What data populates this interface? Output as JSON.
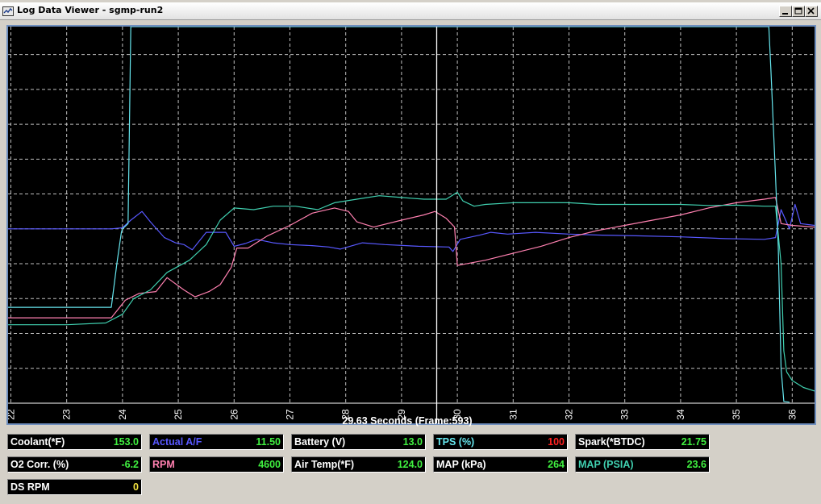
{
  "window": {
    "title": "Log Data Viewer - sgmp-run2",
    "icon": "log-viewer-icon",
    "controls": [
      "minimize-icon",
      "maximize-icon",
      "close-icon"
    ]
  },
  "colors": {
    "plot_background": "#000000",
    "grid": "#bfbfbf",
    "cursor_line": "#ffffff",
    "series_af": "#5858ff",
    "series_rpm": "#ff80b0",
    "series_map_kpa": "#40d0b0",
    "series_map_psia": "#66e6ee"
  },
  "chart_data": {
    "type": "line",
    "xlabel": "",
    "ylabel": "",
    "xlim": [
      21.95,
      36.4
    ],
    "ylim": [
      0,
      10.8
    ],
    "grid": true,
    "x_ticks": [
      "22",
      "23",
      "24",
      "25",
      "26",
      "27",
      "28",
      "29",
      "30",
      "31",
      "32",
      "33",
      "34",
      "35",
      "36"
    ],
    "cursor_x": 29.63,
    "series": [
      {
        "color": "#5858ff",
        "points": [
          [
            21.95,
            5.0
          ],
          [
            23.8,
            5.0
          ],
          [
            24.0,
            5.03
          ],
          [
            24.15,
            5.25
          ],
          [
            24.35,
            5.5
          ],
          [
            24.5,
            5.2
          ],
          [
            24.75,
            4.75
          ],
          [
            24.95,
            4.6
          ],
          [
            25.1,
            4.55
          ],
          [
            25.25,
            4.4
          ],
          [
            25.5,
            4.9
          ],
          [
            25.85,
            4.9
          ],
          [
            26.0,
            4.5
          ],
          [
            26.2,
            4.58
          ],
          [
            26.4,
            4.7
          ],
          [
            26.7,
            4.6
          ],
          [
            27.0,
            4.55
          ],
          [
            27.4,
            4.52
          ],
          [
            27.7,
            4.48
          ],
          [
            27.9,
            4.42
          ],
          [
            28.3,
            4.6
          ],
          [
            28.7,
            4.55
          ],
          [
            29.3,
            4.5
          ],
          [
            29.85,
            4.48
          ],
          [
            29.92,
            4.35
          ],
          [
            30.05,
            4.7
          ],
          [
            30.4,
            4.82
          ],
          [
            30.6,
            4.9
          ],
          [
            30.9,
            4.85
          ],
          [
            31.4,
            4.9
          ],
          [
            32.0,
            4.85
          ],
          [
            32.6,
            4.82
          ],
          [
            33.2,
            4.8
          ],
          [
            34.0,
            4.77
          ],
          [
            34.8,
            4.72
          ],
          [
            35.5,
            4.7
          ],
          [
            35.7,
            4.75
          ],
          [
            35.8,
            5.55
          ],
          [
            35.95,
            5.0
          ],
          [
            36.05,
            5.7
          ],
          [
            36.15,
            5.15
          ],
          [
            36.4,
            5.1
          ]
        ]
      },
      {
        "color": "#ff80b0",
        "points": [
          [
            21.95,
            2.45
          ],
          [
            23.8,
            2.45
          ],
          [
            24.05,
            2.95
          ],
          [
            24.3,
            3.15
          ],
          [
            24.6,
            3.2
          ],
          [
            24.8,
            3.6
          ],
          [
            25.1,
            3.25
          ],
          [
            25.3,
            3.05
          ],
          [
            25.55,
            3.2
          ],
          [
            25.75,
            3.4
          ],
          [
            25.95,
            3.9
          ],
          [
            26.05,
            4.45
          ],
          [
            26.25,
            4.45
          ],
          [
            26.6,
            4.8
          ],
          [
            27.0,
            5.1
          ],
          [
            27.4,
            5.45
          ],
          [
            27.8,
            5.6
          ],
          [
            28.05,
            5.5
          ],
          [
            28.2,
            5.2
          ],
          [
            28.5,
            5.05
          ],
          [
            29.0,
            5.25
          ],
          [
            29.4,
            5.4
          ],
          [
            29.6,
            5.5
          ],
          [
            29.8,
            5.3
          ],
          [
            29.95,
            5.05
          ],
          [
            30.0,
            3.95
          ],
          [
            30.5,
            4.1
          ],
          [
            31.0,
            4.3
          ],
          [
            31.5,
            4.5
          ],
          [
            32.0,
            4.75
          ],
          [
            32.5,
            4.95
          ],
          [
            33.0,
            5.1
          ],
          [
            33.5,
            5.25
          ],
          [
            34.0,
            5.4
          ],
          [
            34.5,
            5.6
          ],
          [
            35.0,
            5.75
          ],
          [
            35.5,
            5.85
          ],
          [
            35.7,
            5.9
          ],
          [
            35.8,
            5.15
          ],
          [
            36.0,
            5.1
          ],
          [
            36.4,
            5.05
          ]
        ]
      },
      {
        "color": "#40d0b0",
        "points": [
          [
            21.95,
            2.25
          ],
          [
            23.0,
            2.25
          ],
          [
            23.7,
            2.3
          ],
          [
            24.0,
            2.55
          ],
          [
            24.2,
            3.0
          ],
          [
            24.5,
            3.25
          ],
          [
            24.8,
            3.75
          ],
          [
            25.2,
            4.1
          ],
          [
            25.5,
            4.55
          ],
          [
            25.75,
            5.25
          ],
          [
            26.0,
            5.6
          ],
          [
            26.35,
            5.55
          ],
          [
            26.7,
            5.65
          ],
          [
            27.1,
            5.65
          ],
          [
            27.5,
            5.55
          ],
          [
            27.8,
            5.75
          ],
          [
            28.2,
            5.85
          ],
          [
            28.6,
            5.95
          ],
          [
            29.0,
            5.9
          ],
          [
            29.4,
            5.85
          ],
          [
            29.8,
            5.85
          ],
          [
            30.0,
            6.05
          ],
          [
            30.1,
            5.8
          ],
          [
            30.3,
            5.65
          ],
          [
            30.5,
            5.7
          ],
          [
            31.0,
            5.75
          ],
          [
            31.5,
            5.75
          ],
          [
            32.0,
            5.75
          ],
          [
            32.5,
            5.7
          ],
          [
            33.0,
            5.7
          ],
          [
            33.5,
            5.7
          ],
          [
            34.0,
            5.7
          ],
          [
            34.5,
            5.67
          ],
          [
            35.0,
            5.68
          ],
          [
            35.5,
            5.65
          ],
          [
            35.7,
            5.65
          ],
          [
            35.8,
            4.0
          ],
          [
            35.85,
            1.5
          ],
          [
            35.9,
            0.9
          ],
          [
            36.0,
            0.65
          ],
          [
            36.2,
            0.45
          ],
          [
            36.4,
            0.35
          ]
        ]
      },
      {
        "color": "#66e6ee",
        "points": [
          [
            21.95,
            2.75
          ],
          [
            23.8,
            2.75
          ],
          [
            23.9,
            4.0
          ],
          [
            23.98,
            4.9
          ],
          [
            24.0,
            5.0
          ],
          [
            24.1,
            5.15
          ],
          [
            24.15,
            10.8
          ],
          [
            35.58,
            10.8
          ],
          [
            35.62,
            9.5
          ],
          [
            35.7,
            6.5
          ],
          [
            35.75,
            4.5
          ],
          [
            35.8,
            1.0
          ],
          [
            35.85,
            0.05
          ],
          [
            35.95,
            0.03
          ]
        ]
      }
    ]
  },
  "cursor_readout": "29.63 Seconds (Frame:593)",
  "gauges": [
    {
      "label": "Coolant(*F)",
      "value": "153.0",
      "label_color": "#ffffff",
      "value_color": "#40f040"
    },
    {
      "label": "Actual A/F",
      "value": "11.50",
      "label_color": "#5858ff",
      "value_color": "#40f040"
    },
    {
      "label": "Battery (V)",
      "value": "13.0",
      "label_color": "#ffffff",
      "value_color": "#40f040"
    },
    {
      "label": "TPS (%)",
      "value": "100",
      "label_color": "#66e6ee",
      "value_color": "#ff2020"
    },
    {
      "label": "Spark(*BTDC)",
      "value": "21.75",
      "label_color": "#ffffff",
      "value_color": "#40f040"
    },
    {
      "label": "O2 Corr. (%)",
      "value": "-6.2",
      "label_color": "#ffffff",
      "value_color": "#40f040"
    },
    {
      "label": "RPM",
      "value": "4600",
      "label_color": "#ff80b0",
      "value_color": "#40f040"
    },
    {
      "label": "Air Temp(*F)",
      "value": "124.0",
      "label_color": "#ffffff",
      "value_color": "#40f040"
    },
    {
      "label": "MAP (kPa)",
      "value": "264",
      "label_color": "#ffffff",
      "value_color": "#40f040"
    },
    {
      "label": "MAP (PSIA)",
      "value": "23.6",
      "label_color": "#40d0b0",
      "value_color": "#40f040"
    },
    {
      "label": "DS RPM",
      "value": "0",
      "label_color": "#ffffff",
      "value_color": "#f0e040"
    }
  ]
}
